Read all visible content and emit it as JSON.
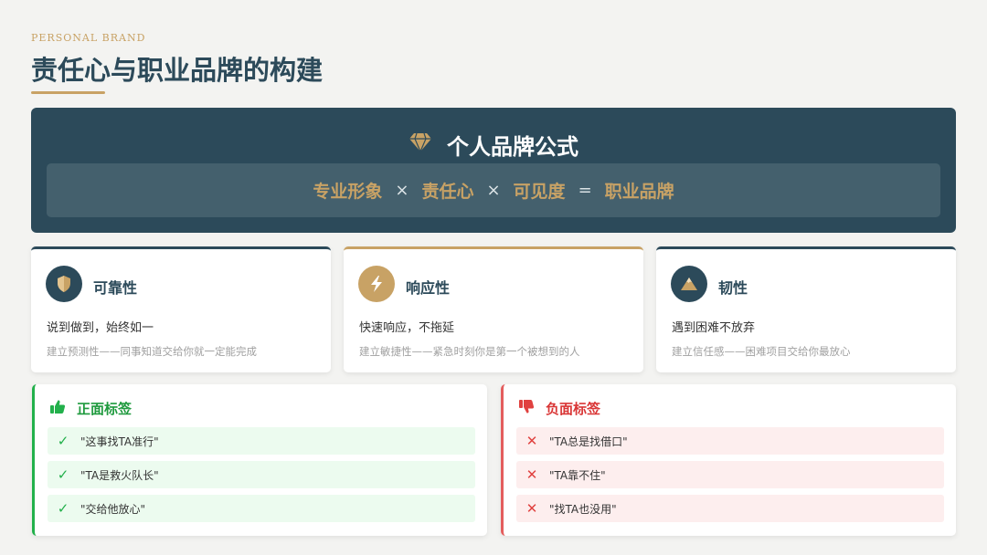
{
  "header": {
    "eyebrow": "PERSONAL BRAND",
    "title": "责任心与职业品牌的构建"
  },
  "formula": {
    "icon": "diamond-icon",
    "title": "个人品牌公式",
    "terms": [
      "专业形象",
      "责任心",
      "可见度",
      "职业品牌"
    ],
    "operators": [
      "×",
      "×",
      "="
    ]
  },
  "traits": [
    {
      "icon": "shield-icon",
      "name": "可靠性",
      "lead": "说到做到，始终如一",
      "desc": "建立预测性——同事知道交给你就一定能完成"
    },
    {
      "icon": "lightning-icon",
      "name": "响应性",
      "lead": "快速响应，不拖延",
      "desc": "建立敏捷性——紧急时刻你是第一个被想到的人"
    },
    {
      "icon": "mountain-icon",
      "name": "韧性",
      "lead": "遇到困难不放弃",
      "desc": "建立信任感——困难项目交给你最放心"
    }
  ],
  "positive": {
    "icon": "thumbs-up-icon",
    "title": "正面标签",
    "items": [
      "\"这事找TA准行\"",
      "\"TA是救火队长\"",
      "\"交给他放心\""
    ]
  },
  "negative": {
    "icon": "thumbs-down-icon",
    "title": "负面标签",
    "items": [
      "\"TA总是找借口\"",
      "\"TA靠不住\"",
      "\"找TA也没用\""
    ]
  },
  "colors": {
    "navy": "#2c4a5a",
    "gold": "#c8a265",
    "green": "#22b04b",
    "red": "#e0413f"
  }
}
